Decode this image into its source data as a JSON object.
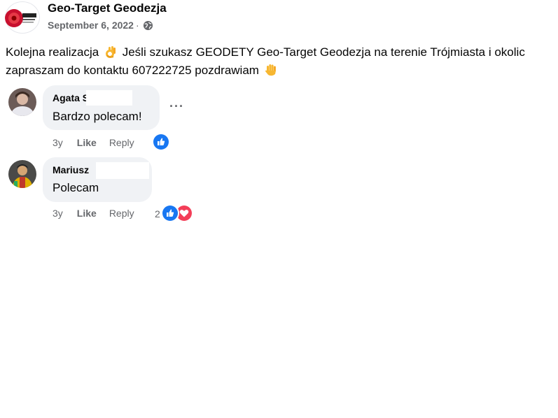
{
  "post": {
    "page_name": "Geo-Target Geodezja",
    "date": "September 6, 2022",
    "separator": "·",
    "privacy_icon": "globe-icon",
    "text_part1": "Kolejna realizacja",
    "text_part2": "Jeśli szukasz GEODETY Geo-Target Geodezja na terenie Trójmiasta i okolic zapraszam do kontaktu 607222725 pozdrawiam",
    "emoji_1": "ok-hand-emoji",
    "emoji_2": "raised-hand-emoji"
  },
  "comments": [
    {
      "author": "Agata S",
      "text": "Bardzo polecam!",
      "time": "3y",
      "like_label": "Like",
      "reply_label": "Reply",
      "reactions": [
        "like"
      ],
      "reaction_count": "",
      "more_label": "···"
    },
    {
      "author": "Mariusz",
      "text": "Polecam",
      "time": "3y",
      "like_label": "Like",
      "reply_label": "Reply",
      "reactions": [
        "like",
        "love"
      ],
      "reaction_count": "2"
    }
  ],
  "colors": {
    "text_primary": "#050505",
    "text_secondary": "#65676b",
    "bubble_bg": "#f0f2f5",
    "like_blue": "#1877f2",
    "love_red": "#f33e58"
  }
}
